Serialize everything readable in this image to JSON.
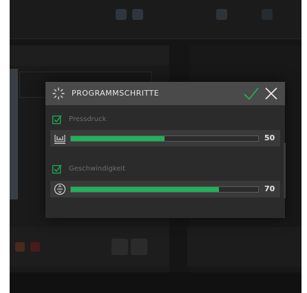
{
  "dialog": {
    "title": "PROGRAMMSCHRITTE",
    "icons": {
      "header": "loading-spinner-icon",
      "confirm": "check-icon",
      "close": "close-icon"
    },
    "accent_color": "#1fb359"
  },
  "steps": [
    {
      "label": "Pressdruck",
      "checked": true,
      "icon": "pressure-gauge-icon",
      "value": "50",
      "level": 0.5
    },
    {
      "label": "Geschwindigkeit",
      "checked": true,
      "icon": "speed-icon",
      "value": "70",
      "level": 0.79
    }
  ]
}
